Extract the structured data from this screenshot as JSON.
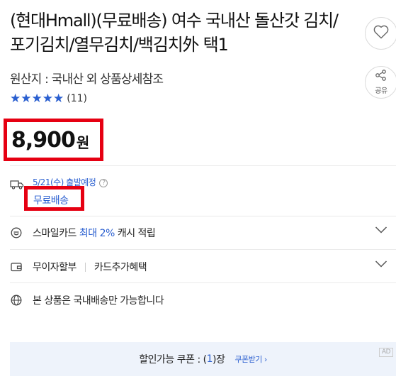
{
  "product": {
    "title": "(현대Hmall)(무료배송) 여수 국내산 돌산갓 김치/포기김치/열무김치/백김치外 택1",
    "origin": "원산지 : 국내산 외 상품상세참조",
    "rating_stars": 5,
    "review_count": "(11)",
    "price": "8,900",
    "currency": "원"
  },
  "actions": {
    "share_label": "공유"
  },
  "shipping": {
    "date": "5/21(수) 출발예정",
    "free": "무료배송"
  },
  "benefits": {
    "smile_card_prefix": "스마일카드",
    "smile_card_highlight": "최대 2%",
    "smile_card_suffix": "캐시 적립",
    "installment": "무이자할부",
    "card_benefit": "카드추가혜택",
    "domestic_only": "본 상품은 국내배송만 가능합니다"
  },
  "coupon": {
    "prefix": "할인가능 쿠폰 : (",
    "count": "1",
    "suffix": ")장",
    "get_label": "쿠폰받기",
    "ad_label": "AD"
  },
  "colors": {
    "accent": "#2a5fd0",
    "highlight_box": "#e60012"
  }
}
